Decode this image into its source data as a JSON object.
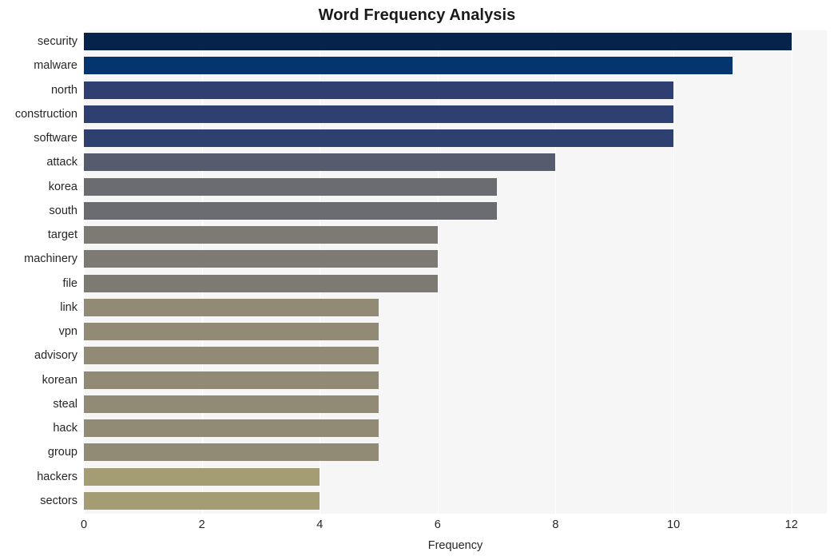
{
  "chart_data": {
    "type": "bar",
    "orientation": "horizontal",
    "title": "Word Frequency Analysis",
    "xlabel": "Frequency",
    "ylabel": "",
    "categories": [
      "security",
      "malware",
      "north",
      "construction",
      "software",
      "attack",
      "korea",
      "south",
      "target",
      "machinery",
      "file",
      "link",
      "vpn",
      "advisory",
      "korean",
      "steal",
      "hack",
      "group",
      "hackers",
      "sectors"
    ],
    "values": [
      12,
      11,
      10,
      10,
      10,
      8,
      7,
      7,
      6,
      6,
      6,
      5,
      5,
      5,
      5,
      5,
      5,
      5,
      4,
      4
    ],
    "bar_colors": [
      "#05234b",
      "#04356f",
      "#2f3f72",
      "#2e3f71",
      "#2d4070",
      "#565c6e",
      "#6b6c72",
      "#6b6c72",
      "#7c7a73",
      "#7c7a73",
      "#7c7a73",
      "#918b75",
      "#918b75",
      "#918b75",
      "#918b75",
      "#918b75",
      "#918b75",
      "#918b75",
      "#a49c73",
      "#a49c73"
    ],
    "xticks": [
      "0",
      "2",
      "4",
      "6",
      "8",
      "10",
      "12"
    ],
    "xtick_values": [
      0,
      2,
      4,
      6,
      8,
      10,
      12
    ],
    "xlim": [
      0,
      12.6
    ],
    "grid": true,
    "grid_axis": "x",
    "legend": "none",
    "plot_background": "#f6f6f6",
    "figure_background": "#ffffff",
    "title_color": "#1a1a1a",
    "tick_color": "#262626"
  }
}
